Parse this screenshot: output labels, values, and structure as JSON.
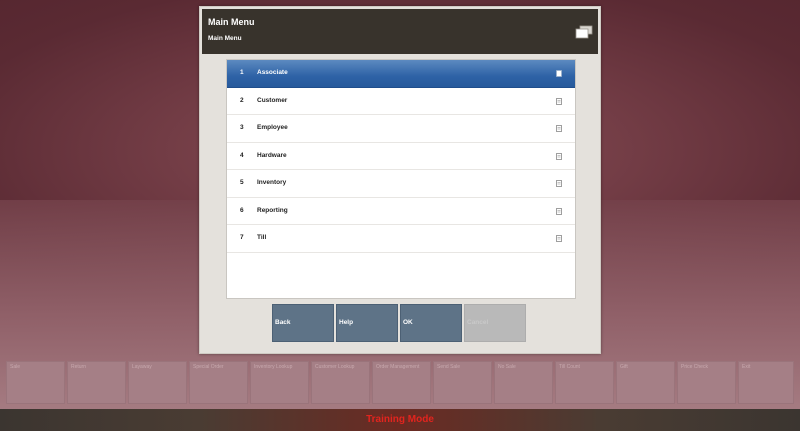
{
  "dialog": {
    "title": "Main Menu",
    "subtitle": "Main Menu",
    "header_icon": "copy-windows-icon"
  },
  "menu": {
    "items": [
      {
        "num": "1",
        "label": "Associate",
        "selected": true
      },
      {
        "num": "2",
        "label": "Customer",
        "selected": false
      },
      {
        "num": "3",
        "label": "Employee",
        "selected": false
      },
      {
        "num": "4",
        "label": "Hardware",
        "selected": false
      },
      {
        "num": "5",
        "label": "Inventory",
        "selected": false
      },
      {
        "num": "6",
        "label": "Reporting",
        "selected": false
      },
      {
        "num": "7",
        "label": "Till",
        "selected": false
      }
    ],
    "item_icon": "document-icon"
  },
  "buttons": {
    "back": "Back",
    "help": "Help",
    "ok": "OK",
    "cancel": "Cancel"
  },
  "function_keys": [
    {
      "label": "Sale"
    },
    {
      "label": "Return"
    },
    {
      "label": "Layaway"
    },
    {
      "label": "Special Order"
    },
    {
      "label": "Inventory Lookup"
    },
    {
      "label": "Customer Lookup"
    },
    {
      "label": "Order Management"
    },
    {
      "label": "Send Sale"
    },
    {
      "label": "No Sale"
    },
    {
      "label": "Till Count"
    },
    {
      "label": "Gift"
    },
    {
      "label": "Price Check"
    },
    {
      "label": "Exit"
    }
  ],
  "status": {
    "text": "Training Mode"
  },
  "colors": {
    "accent": "#2e62a6",
    "status_text": "#e2241e",
    "header_bg": "#38332c",
    "button_bg": "#5e7387"
  }
}
